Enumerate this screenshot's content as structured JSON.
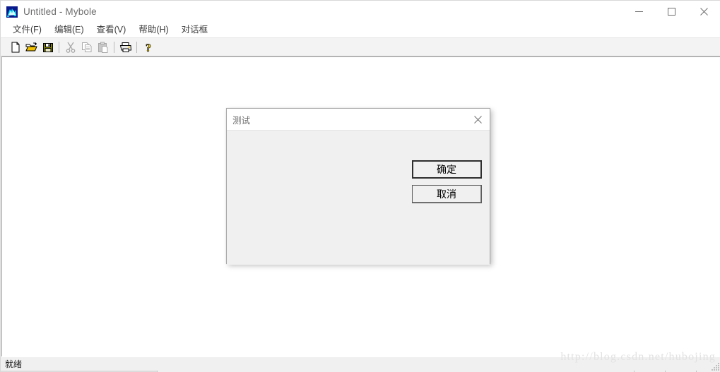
{
  "window": {
    "title": "Untitled - Mybole",
    "icon": "app-icon",
    "controls": {
      "minimize": "minimize-icon",
      "maximize": "maximize-icon",
      "close": "close-icon"
    }
  },
  "menubar": {
    "items": [
      {
        "label": "文件(F)",
        "name": "menu-file"
      },
      {
        "label": "编辑(E)",
        "name": "menu-edit"
      },
      {
        "label": "查看(V)",
        "name": "menu-view"
      },
      {
        "label": "帮助(H)",
        "name": "menu-help"
      },
      {
        "label": "对话框",
        "name": "menu-dialog"
      }
    ]
  },
  "toolbar": {
    "buttons": [
      {
        "name": "new-icon",
        "tooltip": "New",
        "enabled": true
      },
      {
        "name": "open-icon",
        "tooltip": "Open",
        "enabled": true
      },
      {
        "name": "save-icon",
        "tooltip": "Save",
        "enabled": true
      },
      {
        "name": "cut-icon",
        "tooltip": "Cut",
        "enabled": false
      },
      {
        "name": "copy-icon",
        "tooltip": "Copy",
        "enabled": false
      },
      {
        "name": "paste-icon",
        "tooltip": "Paste",
        "enabled": false
      },
      {
        "name": "print-icon",
        "tooltip": "Print",
        "enabled": true
      },
      {
        "name": "help-icon",
        "tooltip": "About",
        "enabled": true
      }
    ]
  },
  "dialog": {
    "title": "测试",
    "close_icon": "close-icon",
    "ok_label": "确定",
    "cancel_label": "取消"
  },
  "statusbar": {
    "message": "就绪"
  },
  "watermark": {
    "text": "http://blog.csdn.net/hubojing"
  },
  "colors": {
    "window_bg": "#ffffff",
    "dialog_bg": "#f0f0f0",
    "toolbar_bg": "#f3f3f3",
    "title_text": "#6e6e6e",
    "menu_text": "#3c3c3c",
    "folder_yellow": "#f0c000",
    "save_olive": "#808000",
    "help_yellow": "#ffd700"
  }
}
